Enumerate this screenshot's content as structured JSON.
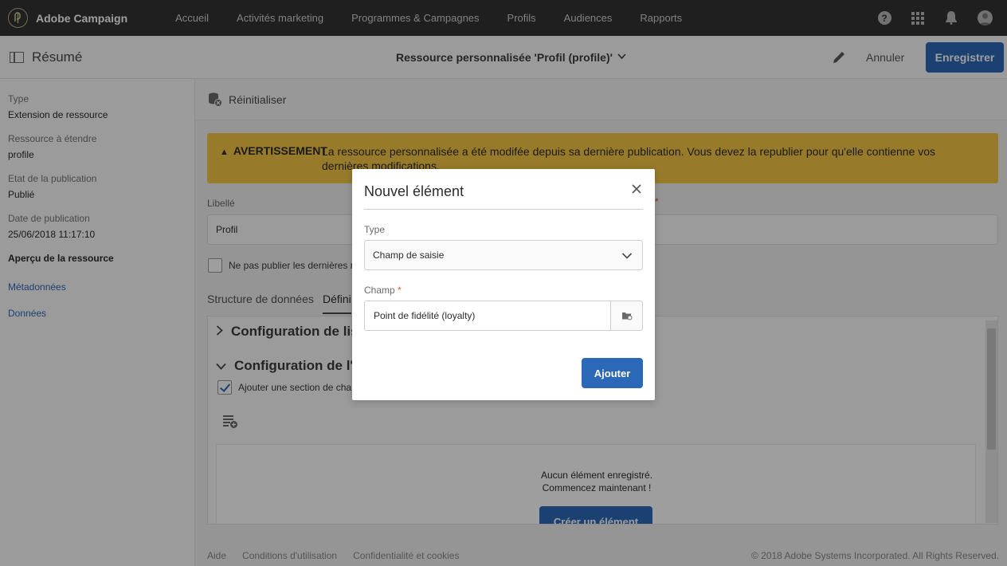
{
  "app": {
    "name": "Adobe Campaign"
  },
  "nav": {
    "items": [
      "Accueil",
      "Activités marketing",
      "Programmes & Campagnes",
      "Profils",
      "Audiences",
      "Rapports"
    ]
  },
  "header": {
    "summary_label": "Résumé",
    "title": "Ressource personnalisée 'Profil (profile)'",
    "cancel_label": "Annuler",
    "save_label": "Enregistrer"
  },
  "sidebar": {
    "type_label": "Type",
    "type_value": "Extension de ressource",
    "resource_label": "Ressource à étendre",
    "resource_value": "profile",
    "pub_state_label": "Etat de la publication",
    "pub_state_value": "Publié",
    "pub_date_label": "Date de publication",
    "pub_date_value": "25/06/2018 11:17:10",
    "preview_label": "Aperçu de la ressource",
    "links": [
      "Métadonnées",
      "Données"
    ]
  },
  "main": {
    "reset_label": "Réinitialiser",
    "warning_tag": "AVERTISSEMENT",
    "warning_text": "La ressource personnalisée a été modifée depuis sa dernière publication. Vous devez la republier pour qu'elle contienne vos dernières modifications.",
    "libelle_label": "Libellé",
    "libelle_value": "Profil",
    "checkbox_label": "Ne pas publier les dernières m",
    "tabs": [
      "Structure de données",
      "Défini"
    ],
    "section1": "Configuration de list",
    "section2": "Configuration de l'éc",
    "section_checkbox_label": "Ajouter une section de char",
    "empty_line1": "Aucun élément enregistré.",
    "empty_line2": "Commencez maintenant !",
    "create_label": "Créer un élément"
  },
  "footer": {
    "links": [
      "Aide",
      "Conditions d'utilisation",
      "Confidentialité et cookies"
    ],
    "copyright": "© 2018 Adobe Systems Incorporated. All Rights Reserved."
  },
  "modal": {
    "title": "Nouvel élément",
    "type_label": "Type",
    "type_value": "Champ de saisie",
    "champ_label": "Champ",
    "required_mark": "*",
    "champ_value": "Point de fidélité (loyalty)",
    "add_label": "Ajouter"
  },
  "colors": {
    "accent": "#2c68b8",
    "warning": "#f4c744",
    "topbar": "#323232"
  }
}
